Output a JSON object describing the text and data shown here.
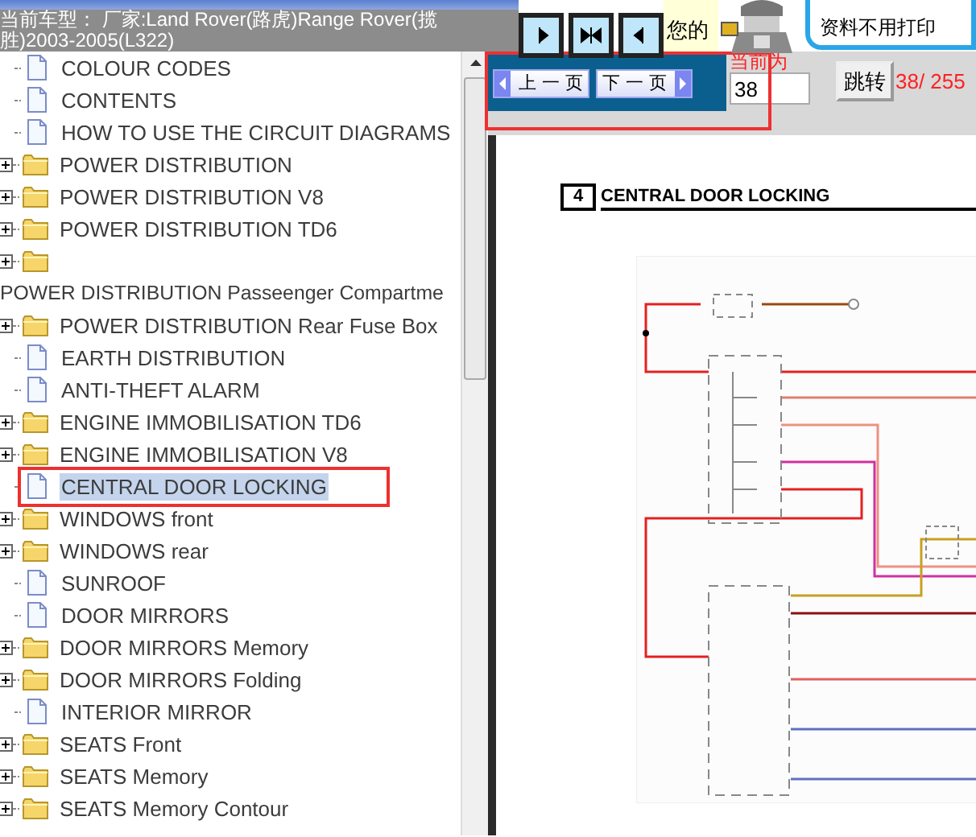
{
  "header": {
    "vehicle": "当前车型： 厂家:Land Rover(路虎)Range Rover(揽胜)2003-2005(L322)",
    "notice": "您的",
    "ad_text": "资料不用打印"
  },
  "tree": {
    "items": [
      {
        "label": "COLOUR CODES",
        "kind": "page",
        "selected": false
      },
      {
        "label": "CONTENTS",
        "kind": "page",
        "selected": false
      },
      {
        "label": "HOW TO USE THE CIRCUIT DIAGRAMS",
        "kind": "page",
        "selected": false
      },
      {
        "label": "POWER DISTRIBUTION",
        "kind": "folder",
        "expanded": false,
        "selected": false
      },
      {
        "label": "POWER DISTRIBUTION V8",
        "kind": "folder",
        "expanded": false,
        "selected": false
      },
      {
        "label": "POWER DISTRIBUTION TD6",
        "kind": "folder",
        "expanded": false,
        "selected": false
      },
      {
        "label": "POWER DISTRIBUTION Passeenger Compartme",
        "kind": "folder-wrapped",
        "expanded": false,
        "selected": false
      },
      {
        "label": "POWER DISTRIBUTION Rear Fuse Box",
        "kind": "folder",
        "expanded": false,
        "selected": false
      },
      {
        "label": "EARTH DISTRIBUTION",
        "kind": "page",
        "selected": false
      },
      {
        "label": "ANTI-THEFT ALARM",
        "kind": "page",
        "selected": false
      },
      {
        "label": "ENGINE IMMOBILISATION TD6",
        "kind": "folder",
        "expanded": false,
        "selected": false
      },
      {
        "label": "ENGINE IMMOBILISATION V8",
        "kind": "folder",
        "expanded": false,
        "selected": false
      },
      {
        "label": "CENTRAL DOOR LOCKING",
        "kind": "page",
        "selected": true
      },
      {
        "label": "WINDOWS front",
        "kind": "folder",
        "expanded": false,
        "selected": false
      },
      {
        "label": "WINDOWS rear",
        "kind": "folder",
        "expanded": false,
        "selected": false
      },
      {
        "label": "SUNROOF",
        "kind": "page",
        "selected": false
      },
      {
        "label": "DOOR MIRRORS",
        "kind": "page",
        "selected": false
      },
      {
        "label": "DOOR MIRRORS Memory",
        "kind": "folder",
        "expanded": false,
        "selected": false
      },
      {
        "label": "DOOR MIRRORS Folding",
        "kind": "folder",
        "expanded": false,
        "selected": false
      },
      {
        "label": "INTERIOR MIRROR",
        "kind": "page",
        "selected": false
      },
      {
        "label": "SEATS Front",
        "kind": "folder",
        "expanded": false,
        "selected": false
      },
      {
        "label": "SEATS Memory",
        "kind": "folder",
        "expanded": false,
        "selected": false
      },
      {
        "label": "SEATS Memory Contour",
        "kind": "folder",
        "expanded": false,
        "selected": false
      }
    ]
  },
  "pager": {
    "prev": "上 一 页",
    "next": "下 一 页",
    "current_label": "当前为",
    "page_value": "38",
    "jump": "跳转",
    "page_count": "38/ 255"
  },
  "document": {
    "section_number": "4",
    "title": "CENTRAL DOOR LOCKING"
  }
}
